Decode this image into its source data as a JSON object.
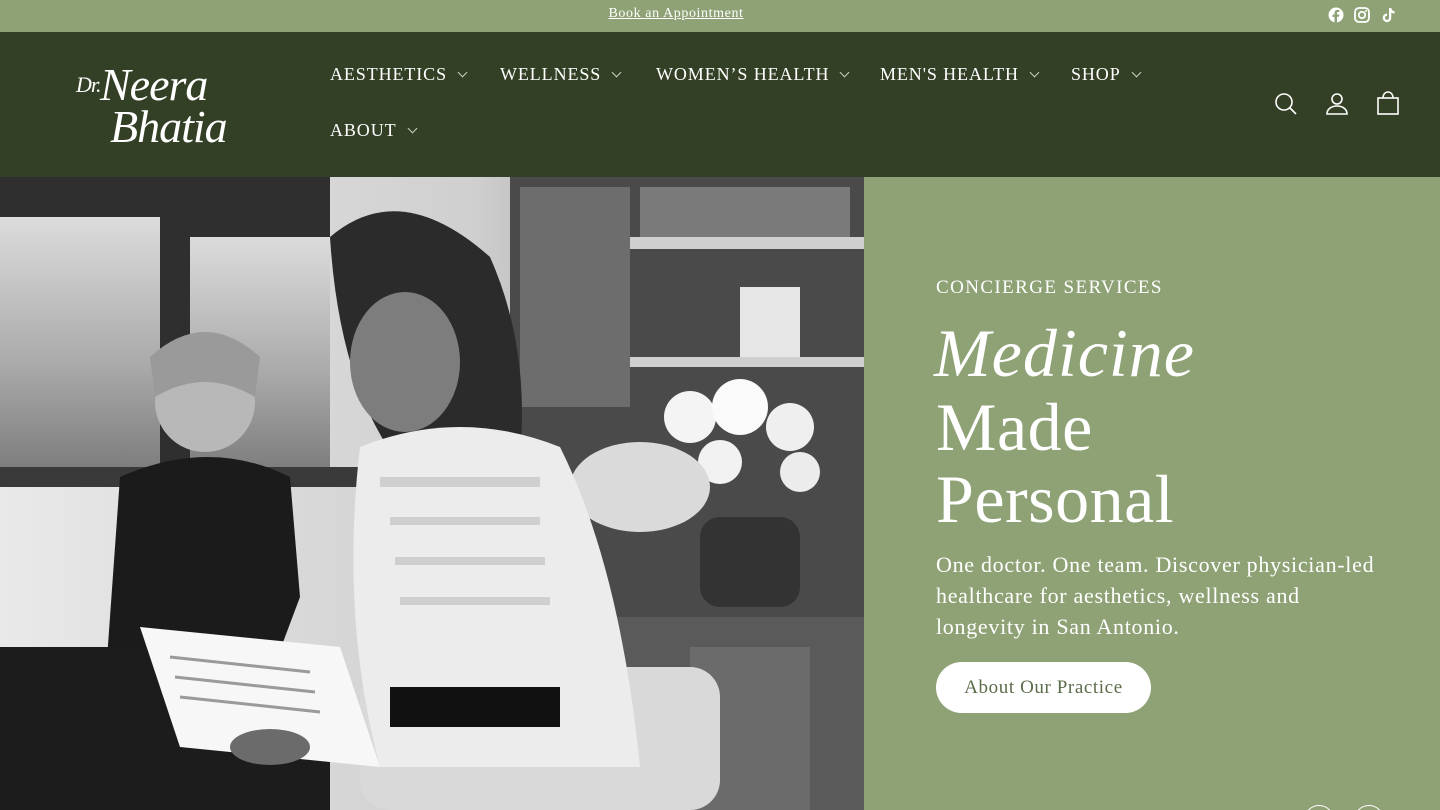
{
  "announcement": {
    "link_text": "Book an Appointment"
  },
  "social_icons": [
    "facebook-icon",
    "instagram-icon",
    "tiktok-icon"
  ],
  "brand": {
    "logo_line1_prefix": "Dr.",
    "logo_line1": "Neera",
    "logo_line2": "Bhatia"
  },
  "nav": {
    "items": [
      {
        "label": "AESTHETICS"
      },
      {
        "label": "WELLNESS"
      },
      {
        "label": "WOMEN’S HEALTH"
      },
      {
        "label": "MEN'S HEALTH"
      },
      {
        "label": "SHOP"
      },
      {
        "label": "ABOUT"
      }
    ]
  },
  "header_icons": [
    "search-icon",
    "account-icon",
    "cart-icon"
  ],
  "hero": {
    "eyebrow": "CONCIERGE SERVICES",
    "heading_line1": "Medicine",
    "heading_line2": "Made",
    "heading_line3": "Personal",
    "description": "One doctor. One team. Discover physician-led healthcare for aesthetics, wellness and longevity in San Antonio.",
    "cta_label": "About Our Practice"
  },
  "colors": {
    "sage": "#8fa276",
    "forest": "#344025",
    "white": "#ffffff",
    "button_text": "#5b6c4b"
  }
}
